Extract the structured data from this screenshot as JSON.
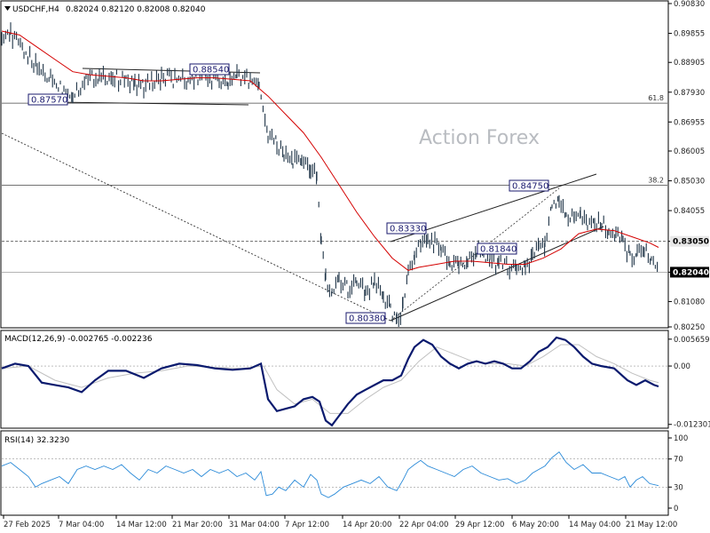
{
  "header": {
    "symbol": "USDCHF,H4",
    "ohlc": "0.82024 0.82120 0.82008 0.82040",
    "macd": "MACD(12,26,9) -0.002765 -0.002236",
    "rsi": "RSI(14) 32.3230"
  },
  "watermark": "Action Forex",
  "colors": {
    "candles": "#1f3447",
    "ma": "#d40000",
    "macd": "#0a1a6e",
    "signal": "#c0c0c0",
    "rsi": "#2a8ad8",
    "box": "#1a1a6e"
  },
  "chart_data": {
    "type": "line",
    "price_axis": {
      "ylim": [
        0.8025,
        0.9083
      ],
      "ticks": [
        "0.90830",
        "0.89855",
        "0.88905",
        "0.87930",
        "0.86955",
        "0.86005",
        "0.85030",
        "0.84055",
        "0.83050",
        "0.82040",
        "0.81080",
        "0.80250"
      ]
    },
    "macd_axis": {
      "ticks": [
        "0.005659",
        "0.00",
        "-0.012301"
      ],
      "ylim": [
        -0.01235,
        0.006
      ]
    },
    "rsi_axis": {
      "ticks": [
        "100",
        "70",
        "30",
        "0"
      ],
      "levels": [
        70,
        30
      ]
    },
    "x_ticks": [
      "27 Feb 2025",
      "7 Mar 04:00",
      "14 Mar 12:00",
      "21 Mar 20:00",
      "31 Mar 04:00",
      "7 Apr 12:00",
      "14 Apr 20:00",
      "22 Apr 04:00",
      "29 Apr 12:00",
      "6 May 20:00",
      "14 May 04:00",
      "21 May 12:00"
    ],
    "annotations": [
      {
        "label": "0.87570",
        "value": 0.8757
      },
      {
        "label": "0.88540",
        "value": 0.8854
      },
      {
        "label": "0.80380",
        "value": 0.8038
      },
      {
        "label": "0.83330",
        "value": 0.8333
      },
      {
        "label": "0.81840",
        "value": 0.8184
      },
      {
        "label": "0.84750",
        "value": 0.8475
      }
    ],
    "fib_levels": [
      {
        "label": "61.8",
        "value": 0.8757
      },
      {
        "label": "38.2",
        "value": 0.8489
      }
    ],
    "price_tags": [
      {
        "label": "0.83050",
        "value": 0.8305,
        "style": "light"
      },
      {
        "label": "0.82040",
        "value": 0.8204,
        "style": "dark"
      }
    ],
    "close_path": [
      [
        0,
        0.899
      ],
      [
        10,
        0.898
      ],
      [
        25,
        0.893
      ],
      [
        40,
        0.887
      ],
      [
        55,
        0.884
      ],
      [
        70,
        0.88
      ],
      [
        80,
        0.879
      ],
      [
        95,
        0.883
      ],
      [
        110,
        0.885
      ],
      [
        125,
        0.884
      ],
      [
        140,
        0.883
      ],
      [
        150,
        0.882
      ],
      [
        160,
        0.881
      ],
      [
        170,
        0.883
      ],
      [
        180,
        0.884
      ],
      [
        195,
        0.8835
      ],
      [
        210,
        0.883
      ],
      [
        230,
        0.884
      ],
      [
        245,
        0.883
      ],
      [
        255,
        0.882
      ],
      [
        265,
        0.884
      ],
      [
        280,
        0.8835
      ],
      [
        290,
        0.882
      ],
      [
        300,
        0.865
      ],
      [
        310,
        0.862
      ],
      [
        318,
        0.859
      ],
      [
        328,
        0.857
      ],
      [
        338,
        0.856
      ],
      [
        348,
        0.854
      ],
      [
        355,
        0.852
      ],
      [
        360,
        0.83
      ],
      [
        365,
        0.818
      ],
      [
        372,
        0.813
      ],
      [
        380,
        0.817
      ],
      [
        390,
        0.815
      ],
      [
        400,
        0.818
      ],
      [
        410,
        0.814
      ],
      [
        420,
        0.817
      ],
      [
        430,
        0.813
      ],
      [
        438,
        0.808
      ],
      [
        445,
        0.8045
      ],
      [
        452,
        0.809
      ],
      [
        458,
        0.82
      ],
      [
        465,
        0.826
      ],
      [
        472,
        0.829
      ],
      [
        480,
        0.831
      ],
      [
        488,
        0.83
      ],
      [
        495,
        0.827
      ],
      [
        505,
        0.823
      ],
      [
        515,
        0.822
      ],
      [
        525,
        0.824
      ],
      [
        535,
        0.828
      ],
      [
        543,
        0.827
      ],
      [
        550,
        0.824
      ],
      [
        560,
        0.823
      ],
      [
        570,
        0.822
      ],
      [
        580,
        0.823
      ],
      [
        590,
        0.821
      ],
      [
        598,
        0.825
      ],
      [
        605,
        0.83
      ],
      [
        612,
        0.829
      ],
      [
        620,
        0.844
      ],
      [
        628,
        0.842
      ],
      [
        636,
        0.838
      ],
      [
        645,
        0.839
      ],
      [
        652,
        0.838
      ],
      [
        660,
        0.836
      ],
      [
        668,
        0.837
      ],
      [
        676,
        0.836
      ],
      [
        684,
        0.834
      ],
      [
        692,
        0.832
      ],
      [
        700,
        0.83
      ],
      [
        708,
        0.825
      ],
      [
        716,
        0.826
      ],
      [
        724,
        0.829
      ],
      [
        732,
        0.823
      ],
      [
        740,
        0.8204
      ]
    ],
    "ma_path": [
      [
        0,
        0.8993
      ],
      [
        20,
        0.898
      ],
      [
        40,
        0.894
      ],
      [
        60,
        0.89
      ],
      [
        80,
        0.886
      ],
      [
        100,
        0.885
      ],
      [
        120,
        0.8845
      ],
      [
        140,
        0.884
      ],
      [
        160,
        0.883
      ],
      [
        180,
        0.883
      ],
      [
        200,
        0.8835
      ],
      [
        220,
        0.884
      ],
      [
        240,
        0.884
      ],
      [
        260,
        0.8835
      ],
      [
        280,
        0.883
      ],
      [
        300,
        0.878
      ],
      [
        320,
        0.872
      ],
      [
        340,
        0.866
      ],
      [
        360,
        0.858
      ],
      [
        380,
        0.849
      ],
      [
        400,
        0.84
      ],
      [
        420,
        0.832
      ],
      [
        440,
        0.825
      ],
      [
        458,
        0.821
      ],
      [
        470,
        0.822
      ],
      [
        490,
        0.823
      ],
      [
        510,
        0.824
      ],
      [
        530,
        0.824
      ],
      [
        550,
        0.8235
      ],
      [
        570,
        0.823
      ],
      [
        590,
        0.823
      ],
      [
        610,
        0.825
      ],
      [
        630,
        0.828
      ],
      [
        650,
        0.833
      ],
      [
        670,
        0.8345
      ],
      [
        690,
        0.834
      ],
      [
        710,
        0.832
      ],
      [
        730,
        0.83
      ],
      [
        740,
        0.8285
      ]
    ],
    "macd_path": [
      [
        0,
        -0.0005
      ],
      [
        15,
        0.0005
      ],
      [
        30,
        0.0
      ],
      [
        45,
        -0.0035
      ],
      [
        60,
        -0.004
      ],
      [
        75,
        -0.0045
      ],
      [
        90,
        -0.0055
      ],
      [
        105,
        -0.003
      ],
      [
        120,
        -0.001
      ],
      [
        140,
        -0.001
      ],
      [
        160,
        -0.0025
      ],
      [
        180,
        -0.0005
      ],
      [
        200,
        0.0005
      ],
      [
        220,
        0.0002
      ],
      [
        240,
        -0.0005
      ],
      [
        260,
        -0.0008
      ],
      [
        280,
        -0.0005
      ],
      [
        292,
        0.0005
      ],
      [
        300,
        -0.007
      ],
      [
        310,
        -0.0095
      ],
      [
        320,
        -0.009
      ],
      [
        330,
        -0.0085
      ],
      [
        340,
        -0.007
      ],
      [
        350,
        -0.0065
      ],
      [
        358,
        -0.0075
      ],
      [
        365,
        -0.0115
      ],
      [
        372,
        -0.0125
      ],
      [
        380,
        -0.0105
      ],
      [
        390,
        -0.008
      ],
      [
        400,
        -0.006
      ],
      [
        410,
        -0.005
      ],
      [
        420,
        -0.004
      ],
      [
        430,
        -0.003
      ],
      [
        440,
        -0.003
      ],
      [
        450,
        -0.002
      ],
      [
        458,
        0.0015
      ],
      [
        465,
        0.004
      ],
      [
        475,
        0.0055
      ],
      [
        485,
        0.0045
      ],
      [
        495,
        0.002
      ],
      [
        505,
        0.0005
      ],
      [
        515,
        -0.0005
      ],
      [
        525,
        0.0005
      ],
      [
        535,
        0.001
      ],
      [
        545,
        0.0005
      ],
      [
        555,
        0.001
      ],
      [
        565,
        0.0005
      ],
      [
        575,
        -0.0005
      ],
      [
        585,
        -0.0005
      ],
      [
        595,
        0.001
      ],
      [
        605,
        0.003
      ],
      [
        615,
        0.004
      ],
      [
        625,
        0.006
      ],
      [
        635,
        0.0055
      ],
      [
        645,
        0.004
      ],
      [
        655,
        0.002
      ],
      [
        665,
        0.0005
      ],
      [
        675,
        0.0
      ],
      [
        690,
        -0.0005
      ],
      [
        705,
        -0.003
      ],
      [
        715,
        -0.004
      ],
      [
        725,
        -0.003
      ],
      [
        735,
        -0.004
      ],
      [
        740,
        -0.0043
      ]
    ],
    "signal_path": [
      [
        0,
        -0.0005
      ],
      [
        30,
        0.0
      ],
      [
        60,
        -0.003
      ],
      [
        90,
        -0.0045
      ],
      [
        120,
        -0.0025
      ],
      [
        150,
        -0.0015
      ],
      [
        180,
        -0.001
      ],
      [
        210,
        0.0
      ],
      [
        240,
        -0.0003
      ],
      [
        270,
        -0.0005
      ],
      [
        295,
        0.0
      ],
      [
        310,
        -0.005
      ],
      [
        330,
        -0.008
      ],
      [
        350,
        -0.007
      ],
      [
        370,
        -0.01
      ],
      [
        390,
        -0.01
      ],
      [
        410,
        -0.007
      ],
      [
        430,
        -0.0045
      ],
      [
        450,
        -0.003
      ],
      [
        470,
        0.001
      ],
      [
        490,
        0.004
      ],
      [
        510,
        0.0025
      ],
      [
        530,
        0.001
      ],
      [
        550,
        0.0005
      ],
      [
        570,
        0.0005
      ],
      [
        590,
        0.0
      ],
      [
        610,
        0.002
      ],
      [
        630,
        0.0045
      ],
      [
        650,
        0.0045
      ],
      [
        670,
        0.002
      ],
      [
        690,
        0.0005
      ],
      [
        710,
        -0.0015
      ],
      [
        730,
        -0.003
      ],
      [
        740,
        -0.0035
      ]
    ],
    "rsi_path": [
      [
        0,
        60
      ],
      [
        10,
        65
      ],
      [
        20,
        55
      ],
      [
        30,
        45
      ],
      [
        38,
        30
      ],
      [
        45,
        35
      ],
      [
        55,
        40
      ],
      [
        65,
        45
      ],
      [
        75,
        35
      ],
      [
        85,
        55
      ],
      [
        95,
        60
      ],
      [
        105,
        55
      ],
      [
        115,
        60
      ],
      [
        125,
        55
      ],
      [
        135,
        62
      ],
      [
        145,
        50
      ],
      [
        155,
        40
      ],
      [
        165,
        55
      ],
      [
        175,
        50
      ],
      [
        185,
        60
      ],
      [
        195,
        55
      ],
      [
        205,
        50
      ],
      [
        215,
        55
      ],
      [
        225,
        45
      ],
      [
        235,
        55
      ],
      [
        245,
        50
      ],
      [
        255,
        55
      ],
      [
        265,
        45
      ],
      [
        275,
        50
      ],
      [
        285,
        40
      ],
      [
        292,
        52
      ],
      [
        298,
        18
      ],
      [
        305,
        20
      ],
      [
        312,
        30
      ],
      [
        320,
        25
      ],
      [
        330,
        40
      ],
      [
        340,
        30
      ],
      [
        348,
        48
      ],
      [
        355,
        40
      ],
      [
        360,
        20
      ],
      [
        368,
        15
      ],
      [
        375,
        20
      ],
      [
        385,
        30
      ],
      [
        395,
        35
      ],
      [
        405,
        40
      ],
      [
        415,
        35
      ],
      [
        425,
        45
      ],
      [
        435,
        30
      ],
      [
        445,
        25
      ],
      [
        452,
        40
      ],
      [
        458,
        55
      ],
      [
        465,
        62
      ],
      [
        472,
        68
      ],
      [
        480,
        60
      ],
      [
        490,
        55
      ],
      [
        500,
        50
      ],
      [
        510,
        45
      ],
      [
        520,
        55
      ],
      [
        530,
        60
      ],
      [
        540,
        50
      ],
      [
        550,
        45
      ],
      [
        560,
        40
      ],
      [
        570,
        42
      ],
      [
        580,
        35
      ],
      [
        590,
        40
      ],
      [
        598,
        50
      ],
      [
        605,
        55
      ],
      [
        612,
        60
      ],
      [
        620,
        72
      ],
      [
        628,
        80
      ],
      [
        636,
        65
      ],
      [
        645,
        55
      ],
      [
        655,
        62
      ],
      [
        665,
        50
      ],
      [
        675,
        50
      ],
      [
        685,
        45
      ],
      [
        695,
        40
      ],
      [
        702,
        45
      ],
      [
        708,
        30
      ],
      [
        715,
        40
      ],
      [
        722,
        45
      ],
      [
        730,
        35
      ],
      [
        740,
        32
      ]
    ]
  }
}
